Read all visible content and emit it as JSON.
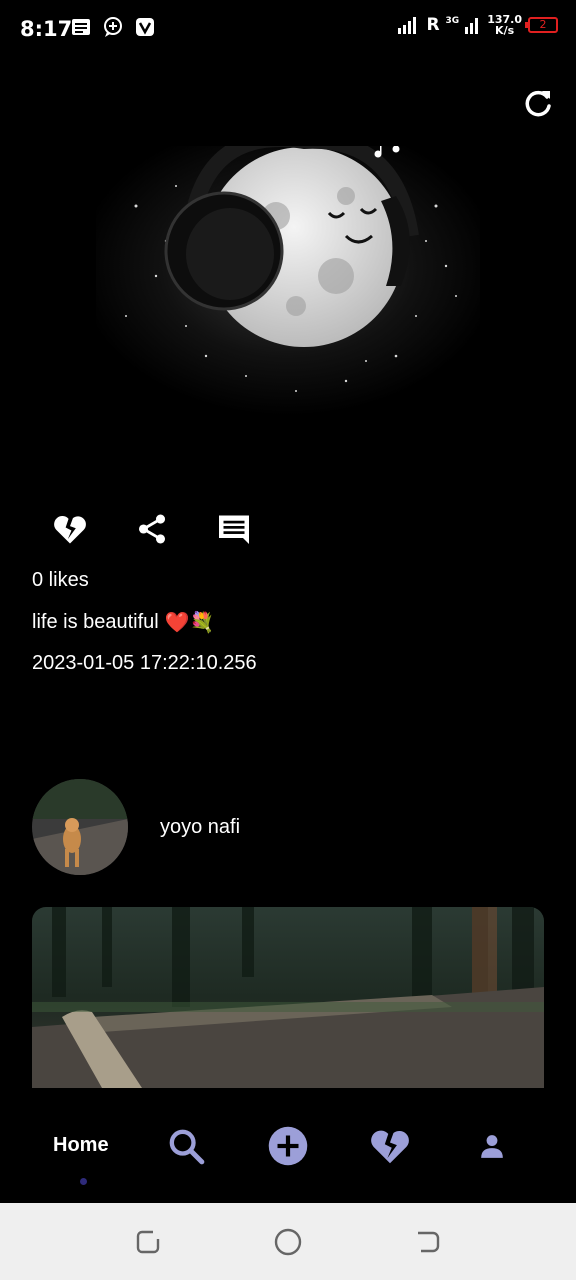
{
  "status_bar": {
    "time": "8:17",
    "network_rate": "137.0",
    "network_unit": "K/s",
    "signal_label": "R",
    "signal_gen": "3G",
    "battery_level": "2"
  },
  "post": {
    "likes": "0 likes",
    "caption": "life is beautiful",
    "caption_emojis": "❤️💐",
    "timestamp": "2023-01-05 17:22:10.256"
  },
  "next_post": {
    "username": "yoyo nafi"
  },
  "bottom_nav": {
    "home_label": "Home",
    "accent_color": "#9c9fd8",
    "active_dot_color": "#2e2a7a"
  },
  "icons": {
    "refresh": "refresh-icon",
    "unlike": "broken-heart-icon",
    "share": "share-icon",
    "comment": "comment-icon",
    "search": "search-icon",
    "add": "add-circle-icon",
    "activity": "broken-heart-icon",
    "profile": "person-icon"
  }
}
